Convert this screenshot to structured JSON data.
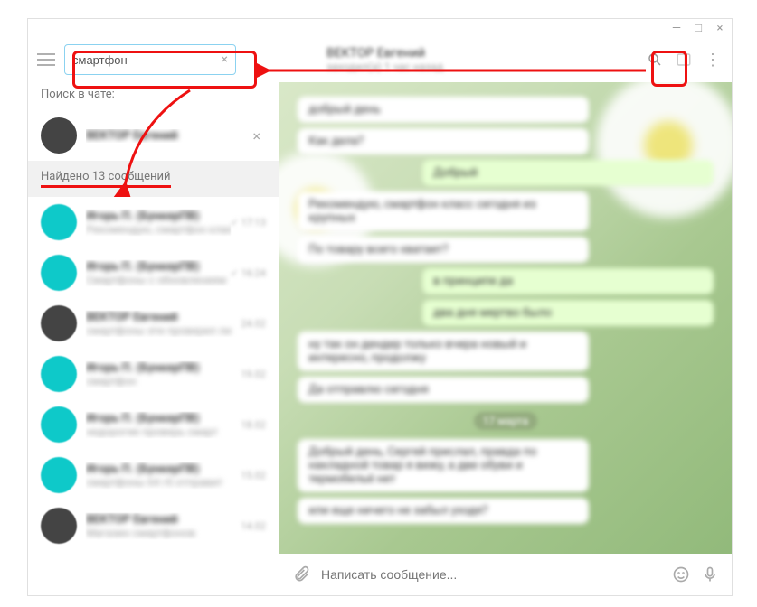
{
  "window": {
    "minimize": "—",
    "maximize": "□",
    "close": "×"
  },
  "search": {
    "value": "смартфон",
    "clear": "×"
  },
  "contact": {
    "name_blurred": "ВЕКТОР Евгений",
    "status": "заходил(а) 1 час назад"
  },
  "sidebar": {
    "search_in_chat": "Поиск в чате:",
    "pinned": {
      "name": "ВЕКТОР Евгений",
      "close": "×"
    },
    "found_label": "Найдено 13 сообщений",
    "items": [
      {
        "name": "Игорь П. (БункерПВ)",
        "sub": "Рекомендую, смартфон класс",
        "meta": "✓ 17:13"
      },
      {
        "name": "Игорь П. (БункерПВ)",
        "sub": "Смартфоны с обновлением",
        "meta": "✓ 16:24"
      },
      {
        "name": "ВЕКТОР Евгений",
        "sub": "смартфоны эти проверил ли",
        "meta": "24.02"
      },
      {
        "name": "Игорь П. (БункерПВ)",
        "sub": "смартфон",
        "meta": "19.02"
      },
      {
        "name": "Игорь П. (БункерПВ)",
        "sub": "недорогие проверь смарт",
        "meta": "18.02"
      },
      {
        "name": "Игорь П. (БункерПВ)",
        "sub": "смартфоны 64 гб отправит",
        "meta": "15.02"
      },
      {
        "name": "ВЕКТОР Евгений",
        "sub": "Магазин смартфонов",
        "meta": "14.02"
      }
    ]
  },
  "chat": {
    "messages": [
      {
        "dir": "in",
        "text": "добрый день"
      },
      {
        "dir": "in",
        "text": "Как дела?"
      },
      {
        "dir": "out",
        "text": "Добрый"
      },
      {
        "dir": "in",
        "text": "Рекомендую, смартфон класс сегодня из крупных"
      },
      {
        "dir": "in",
        "text": "По товару всего хватает?"
      },
      {
        "dir": "out",
        "text": "в принципе да"
      },
      {
        "dir": "out",
        "text": "два дня мертво было"
      },
      {
        "dir": "in",
        "text": "ну так он дендер только вчера новый и интересно, продолжу"
      },
      {
        "dir": "in",
        "text": "Да отправлю сегодня"
      },
      {
        "dir": "in",
        "text": "Добрый день, Сергей прислал, правда по накладной товар я вижу, а две обуви и термобельё нет"
      },
      {
        "dir": "in",
        "text": "или еще ничего не забыл уходя?"
      }
    ],
    "date_chip": "17 марта"
  },
  "composer": {
    "placeholder": "Написать сообщение..."
  }
}
